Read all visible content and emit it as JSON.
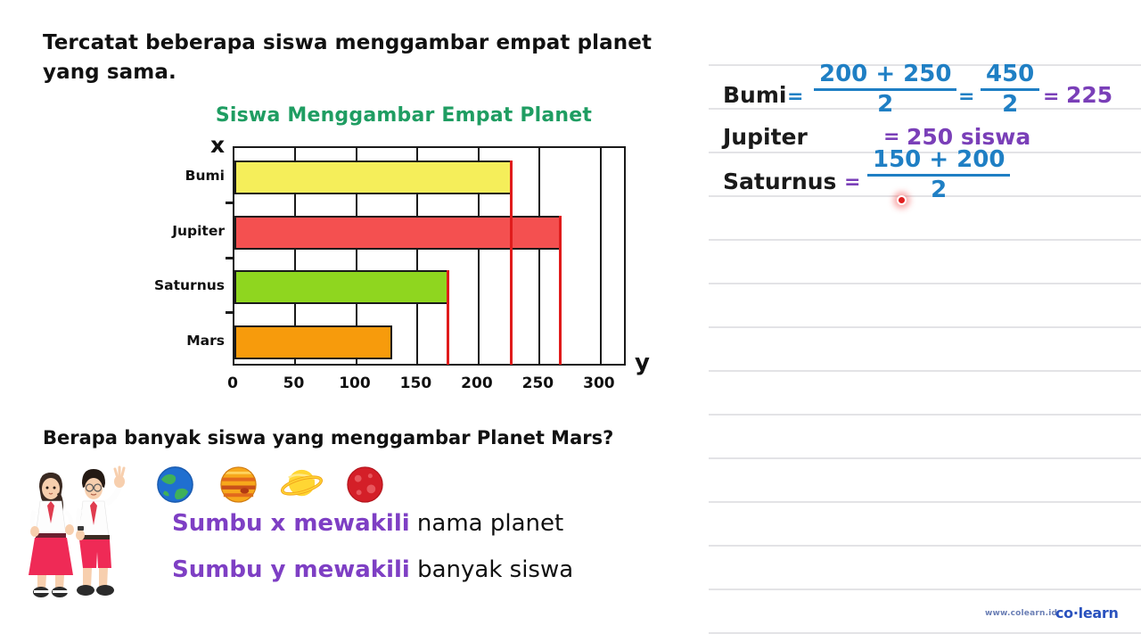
{
  "prompt": "Tercatat beberapa siswa menggambar empat planet yang sama.",
  "question": "Berapa banyak siswa yang menggambar Planet Mars?",
  "chart_data": {
    "type": "bar",
    "orientation": "horizontal",
    "title": "Siswa Menggambar Empat Planet",
    "categories": [
      "Bumi",
      "Jupiter",
      "Saturnus",
      "Mars"
    ],
    "values": [
      227,
      267,
      175,
      129
    ],
    "colors": [
      "#F5EE5A",
      "#F45050",
      "#8FD61F",
      "#F79B0C"
    ],
    "xlabel": "y",
    "ylabel": "x",
    "xticks": [
      "0",
      "50",
      "100",
      "150",
      "200",
      "250",
      "300"
    ],
    "xtick_values": [
      0,
      50,
      100,
      150,
      200,
      250,
      300
    ],
    "xlim": [
      0,
      322
    ],
    "grid": true,
    "grid_axis": "x",
    "legend": "none",
    "markers": [
      {
        "value": 175,
        "color": "#e01b1b",
        "label": "Saturnus marker"
      },
      {
        "value": 227,
        "color": "#e01b1b",
        "label": "Bumi marker"
      },
      {
        "value": 267,
        "color": "#e01b1b",
        "label": "Jupiter marker"
      }
    ]
  },
  "axis_letters": {
    "x": "x",
    "y": "y"
  },
  "worksheet": {
    "rows": [
      {
        "label": "Bumi",
        "eq1": "=",
        "frac1_num": "200 + 250",
        "frac1_den": "2",
        "eq2": "=",
        "frac2_num": "450",
        "frac2_den": "2",
        "eq3": "=",
        "result": "225"
      },
      {
        "label": "Jupiter",
        "eq1": "=",
        "result": "250 siswa"
      },
      {
        "label": "Saturnus",
        "eq1": "=",
        "frac1_num": "150 + 200",
        "frac1_den": "2"
      }
    ]
  },
  "legend_notes": [
    {
      "highlight": "Sumbu x mewakili",
      "rest": " nama planet"
    },
    {
      "highlight": "Sumbu y mewakili",
      "rest": " banyak siswa"
    }
  ],
  "planets": [
    "earth-planet-icon",
    "jupiter-planet-icon",
    "saturn-planet-icon",
    "mars-planet-icon"
  ],
  "footer": {
    "url": "www.colearn.id",
    "brand_a": "co",
    "brand_dot": "·",
    "brand_b": "learn"
  },
  "palette": {
    "title_green": "#1f9d62",
    "accent_purple": "#7a3fb8",
    "accent_blue": "#1f7fc4",
    "marker_red": "#e01b1b"
  }
}
